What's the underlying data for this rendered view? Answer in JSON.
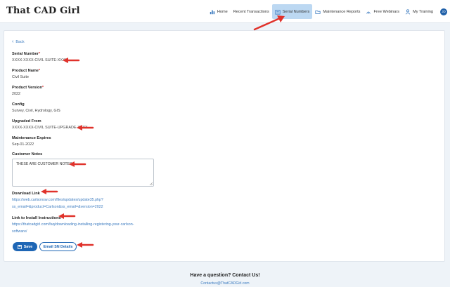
{
  "header": {
    "logo": "That CAD Girl",
    "nav": [
      {
        "label": "Home",
        "icon": "chart-icon"
      },
      {
        "label": "Recent Transactions",
        "icon": "none"
      },
      {
        "label": "Serial Numbers",
        "icon": "serial-icon"
      },
      {
        "label": "Maintenance Reports",
        "icon": "folder-icon"
      },
      {
        "label": "Free Webinars",
        "icon": "signal-icon"
      },
      {
        "label": "My Training",
        "icon": "person-icon"
      }
    ],
    "active_nav": "Serial Numbers",
    "avatar_initials": "JD"
  },
  "form": {
    "back_label": "Back",
    "serial_label": "Serial Number",
    "serial_value": "XXXX-XXXX-CIVIL SUITE-XXXX",
    "product_name_label": "Product Name",
    "product_name_value": "Civil Suite",
    "product_version_label": "Product Version",
    "product_version_value": "2022",
    "config_label": "Config",
    "config_value": "Survey, Civil, Hydrology, GIS",
    "upgraded_label": "Upgraded From",
    "upgraded_value": "XXXX-XXXX-CIVIL SUITE-UPGRADE-XXXX",
    "maint_label": "Maintenance Expires",
    "maint_value": "Sep-01-2022",
    "notes_label": "Customer Notes",
    "notes_value": "THESE ARE CUSTOMER NOTES",
    "download_label": "Download Link",
    "download_line1": "https://web.carlsonsw.com/files/updates/update35.php?",
    "download_line2": "ss_email=&product=Carlson&ss_email=&version=2022",
    "install_label": "Link to Install Instructions",
    "install_line1": "https://thatcadgirl.com/faq/downloading-installing-registering-your-carlson-",
    "install_line2": "software/",
    "save_label": "Save",
    "email_label": "Email SN Details"
  },
  "footer": {
    "title": "Have a question? Contact Us!",
    "email": "Contactus@ThatCADGirl.com"
  },
  "colors": {
    "accent": "#1e66b5",
    "link": "#3d7cc0",
    "arrow": "#e0322b",
    "active_nav_bg": "#bcd8f2"
  }
}
